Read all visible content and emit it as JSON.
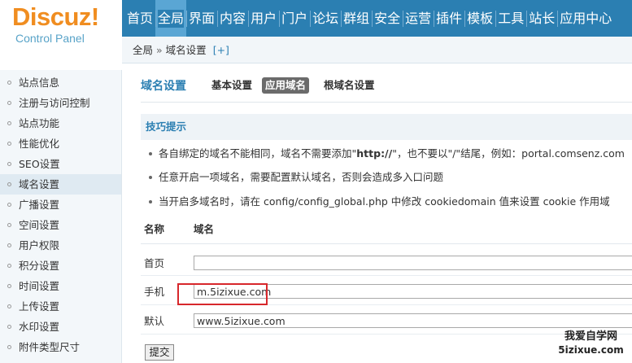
{
  "logo": {
    "main": "Discuz!",
    "sub": "Control Panel"
  },
  "topnav": [
    {
      "label": "首页",
      "active": false
    },
    {
      "label": "全局",
      "active": true
    },
    {
      "label": "界面",
      "active": false
    },
    {
      "label": "内容",
      "active": false
    },
    {
      "label": "用户",
      "active": false
    },
    {
      "label": "门户",
      "active": false
    },
    {
      "label": "论坛",
      "active": false
    },
    {
      "label": "群组",
      "active": false
    },
    {
      "label": "安全",
      "active": false
    },
    {
      "label": "运营",
      "active": false
    },
    {
      "label": "插件",
      "active": false
    },
    {
      "label": "模板",
      "active": false
    },
    {
      "label": "工具",
      "active": false
    },
    {
      "label": "站长",
      "active": false
    },
    {
      "label": "应用中心",
      "active": false
    }
  ],
  "breadcrumb": {
    "root": "全局",
    "separator": "»",
    "current": "域名设置",
    "add": "[+]"
  },
  "sidebar": [
    {
      "label": "站点信息",
      "active": false
    },
    {
      "label": "注册与访问控制",
      "active": false
    },
    {
      "label": "站点功能",
      "active": false
    },
    {
      "label": "性能优化",
      "active": false
    },
    {
      "label": "SEO设置",
      "active": false
    },
    {
      "label": "域名设置",
      "active": true
    },
    {
      "label": "广播设置",
      "active": false
    },
    {
      "label": "空间设置",
      "active": false
    },
    {
      "label": "用户权限",
      "active": false
    },
    {
      "label": "积分设置",
      "active": false
    },
    {
      "label": "时间设置",
      "active": false
    },
    {
      "label": "上传设置",
      "active": false
    },
    {
      "label": "水印设置",
      "active": false
    },
    {
      "label": "附件类型尺寸",
      "active": false
    }
  ],
  "page": {
    "title": "域名设置",
    "tabs": [
      {
        "label": "基本设置",
        "current": false
      },
      {
        "label": "应用域名",
        "current": true
      },
      {
        "label": "根域名设置",
        "current": false
      }
    ]
  },
  "tips": {
    "title": "技巧提示",
    "items": [
      {
        "pre": "各自绑定的域名不能相同，域名不需要添加\"",
        "bold": "http://",
        "post": "\"，也不要以\"/\"结尾，例如：portal.comsenz.com"
      },
      {
        "pre": "任意开启一项域名，需要配置默认域名，否则会造成多入口问题",
        "bold": "",
        "post": ""
      },
      {
        "pre": "当开启多域名时，请在 config/config_global.php 中修改 cookiedomain 值来设置 cookie 作用域",
        "bold": "",
        "post": ""
      }
    ]
  },
  "table": {
    "headers": [
      "名称",
      "域名"
    ],
    "rows": [
      {
        "label": "首页",
        "value": ""
      },
      {
        "label": "手机",
        "value": "m.5izixue.com"
      },
      {
        "label": "默认",
        "value": "www.5izixue.com"
      }
    ]
  },
  "submit_label": "提交",
  "watermark": {
    "line1": "我爱自学网",
    "line2": "5izixue.com"
  },
  "colors": {
    "nav_bg": "#2b7fb2",
    "logo_orange": "#f08d20",
    "highlight_red": "#d7272b"
  }
}
